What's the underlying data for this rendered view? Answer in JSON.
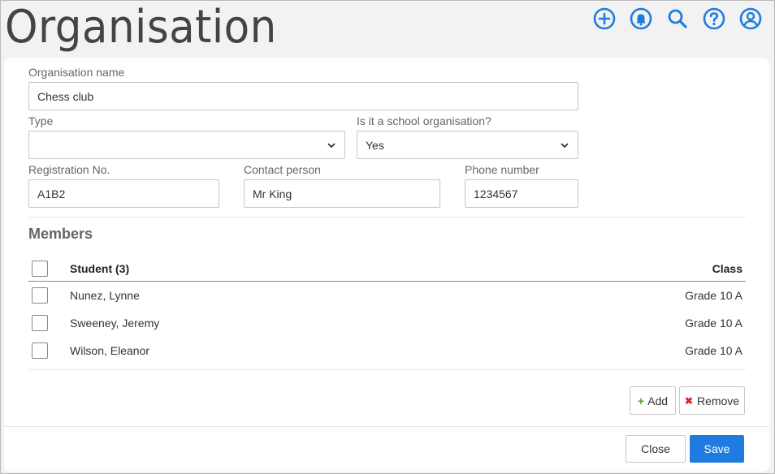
{
  "header": {
    "title": "Organisation",
    "icons": [
      "add-circle-icon",
      "notification-bell-icon",
      "search-icon",
      "help-icon",
      "user-account-icon"
    ],
    "accent_color": "#1f7be0"
  },
  "form": {
    "org_name_label": "Organisation name",
    "org_name_value": "Chess club",
    "type_label": "Type",
    "type_value": "",
    "school_org_label": "Is it a school organisation?",
    "school_org_value": "Yes",
    "reg_label": "Registration No.",
    "reg_value": "A1B2",
    "contact_label": "Contact person",
    "contact_value": "Mr King",
    "phone_label": "Phone number",
    "phone_value": "1234567"
  },
  "members": {
    "title": "Members",
    "header_student": "Student (3)",
    "header_class": "Class",
    "rows": [
      {
        "name": "Nunez, Lynne",
        "class": "Grade 10 A"
      },
      {
        "name": "Sweeney, Jeremy",
        "class": "Grade 10 A"
      },
      {
        "name": "Wilson, Eleanor",
        "class": "Grade 10 A"
      }
    ],
    "add_label": "Add",
    "remove_label": "Remove"
  },
  "footer": {
    "close_label": "Close",
    "save_label": "Save"
  }
}
